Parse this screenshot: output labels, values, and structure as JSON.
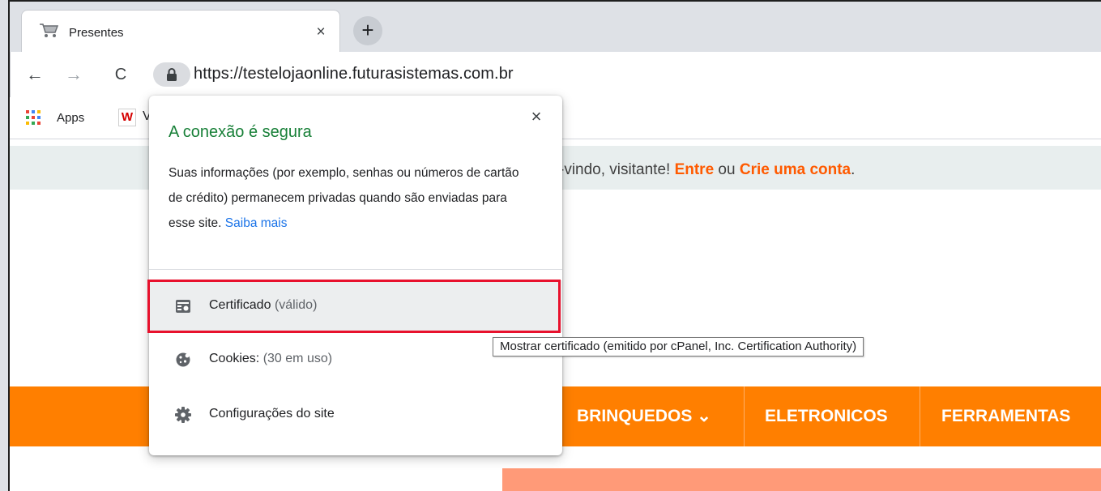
{
  "tab": {
    "title": "Presentes",
    "close": "×"
  },
  "new_tab": "+",
  "toolbar": {
    "back": "←",
    "forward": "→",
    "reload": "C",
    "url": "https://testelojaonline.futurasistemas.com.br"
  },
  "bookmarks": {
    "apps": "Apps",
    "w_label": "W",
    "trail": "V"
  },
  "site": {
    "welcome_prefix": "-vindo, visitante! ",
    "login": "Entre",
    "or": " ou ",
    "signup": "Crie uma conta",
    "period": ".",
    "accent_color": "#ff5a00",
    "nav_color": "#ff7f00",
    "nav": {
      "brinquedos": "BRINQUEDOS",
      "eletronicos": "ELETRONICOS",
      "ferramentas": "FERRAMENTAS"
    },
    "dropdown_glyph": "⌄"
  },
  "popup": {
    "title": "A conexão é segura",
    "description": "Suas informações (por exemplo, senhas ou números de cartão de crédito) permanecem privadas quando são enviadas para esse site.",
    "learn_more": "Saiba mais",
    "close": "×",
    "certificate": {
      "label": "Certificado",
      "status": "(válido)"
    },
    "cookies": {
      "label": "Cookies:",
      "status": "(30 em uso)"
    },
    "settings": {
      "label": "Configurações do site"
    },
    "title_color": "#188038"
  },
  "tooltip": "Mostrar certificado (emitido por cPanel, Inc. Certification Authority)",
  "icons": {
    "tab": "cart-icon",
    "lock": "lock-icon",
    "apps": "apps-grid-icon",
    "certificate": "certificate-icon",
    "cookies": "cookie-icon",
    "settings": "gear-icon"
  }
}
